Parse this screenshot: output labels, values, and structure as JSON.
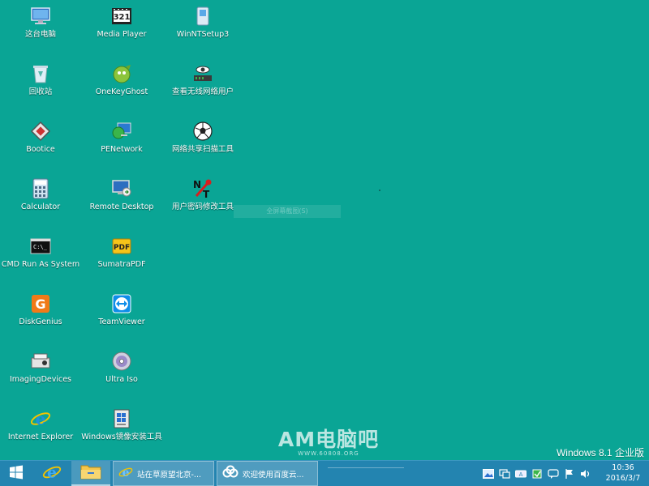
{
  "desktop": {
    "icons": [
      {
        "label": "这台电脑",
        "icon": "computer-icon"
      },
      {
        "label": "Media Player",
        "icon": "media-player-icon"
      },
      {
        "label": "WinNTSetup3",
        "icon": "winntsetup-icon"
      },
      {
        "label": "回收站",
        "icon": "recycle-bin-icon"
      },
      {
        "label": "OneKeyGhost",
        "icon": "ghost-icon"
      },
      {
        "label": "查看无线网络用户",
        "icon": "wireless-viewer-icon"
      },
      {
        "label": "Bootice",
        "icon": "bootice-icon"
      },
      {
        "label": "PENetwork",
        "icon": "network-icon"
      },
      {
        "label": "网络共享扫描工具",
        "icon": "soccer-ball-icon"
      },
      {
        "label": "Calculator",
        "icon": "calculator-icon"
      },
      {
        "label": "Remote Desktop",
        "icon": "remote-desktop-icon"
      },
      {
        "label": "用户密码修改工具",
        "icon": "password-tool-icon"
      },
      {
        "label": "CMD Run As System",
        "icon": "cmd-icon"
      },
      {
        "label": "SumatraPDF",
        "icon": "pdf-icon"
      },
      {
        "label": "DiskGenius",
        "icon": "diskgenius-icon"
      },
      {
        "label": "TeamViewer",
        "icon": "teamviewer-icon"
      },
      {
        "label": "ImagingDevices",
        "icon": "imaging-devices-icon"
      },
      {
        "label": "Ultra Iso",
        "icon": "disc-icon"
      },
      {
        "label": "Internet Explorer",
        "icon": "ie-icon"
      },
      {
        "label": "Windows镜像安装工具",
        "icon": "windows-installer-icon"
      }
    ],
    "ghost_menu": "全屏幕截图(S)",
    "watermark": {
      "title": "AM电脑吧",
      "url": "WWW.60808.ORG"
    },
    "edition": "Windows 8.1 企业版"
  },
  "taskbar": {
    "start_icon": "windows-logo-icon",
    "pinned": [
      {
        "name": "internet-explorer",
        "icon": "ie-icon"
      },
      {
        "name": "file-explorer",
        "icon": "folder-icon"
      }
    ],
    "tasks": [
      {
        "label": "站在草原望北京-...",
        "icon": "ie-icon"
      },
      {
        "label": "欢迎使用百度云...",
        "icon": "baidu-cloud-icon"
      }
    ],
    "tray_icons": [
      "image-icon",
      "network-tray-icon",
      "keyboard-icon",
      "usb-icon",
      "chat-icon",
      "flag-icon",
      "volume-icon"
    ],
    "clock": {
      "time": "10:36",
      "date": "2016/3/7"
    }
  },
  "colors": {
    "desktop": "#0aa595",
    "taskbar": "#2384b0"
  }
}
